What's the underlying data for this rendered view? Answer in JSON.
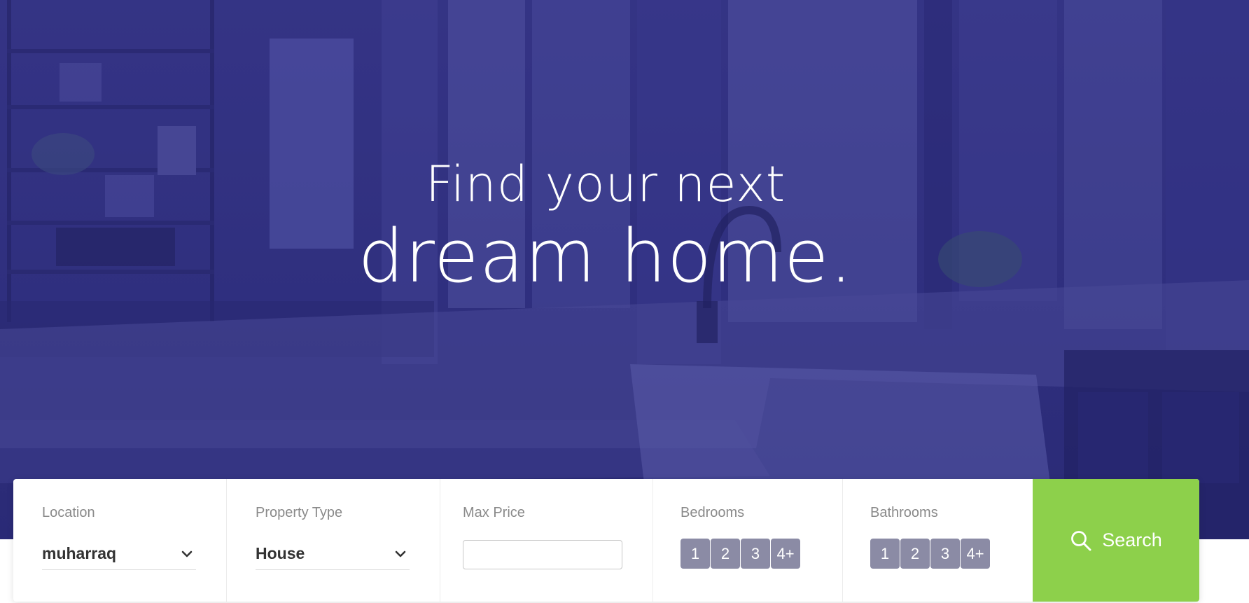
{
  "hero": {
    "line1": "Find your next",
    "line2": "dream home."
  },
  "search": {
    "location": {
      "label": "Location",
      "value": "muharraq"
    },
    "property_type": {
      "label": "Property Type",
      "value": "House"
    },
    "max_price": {
      "label": "Max Price",
      "value": ""
    },
    "bedrooms": {
      "label": "Bedrooms",
      "options": [
        "1",
        "2",
        "3",
        "4+"
      ]
    },
    "bathrooms": {
      "label": "Bathrooms",
      "options": [
        "1",
        "2",
        "3",
        "4+"
      ]
    },
    "button_label": "Search"
  },
  "colors": {
    "hero_overlay": "#33337e",
    "search_button": "#8dd04b",
    "number_button": "#8b8ba5"
  },
  "icons": {
    "select_arrow": "chevron-down-icon",
    "search": "search-icon"
  }
}
